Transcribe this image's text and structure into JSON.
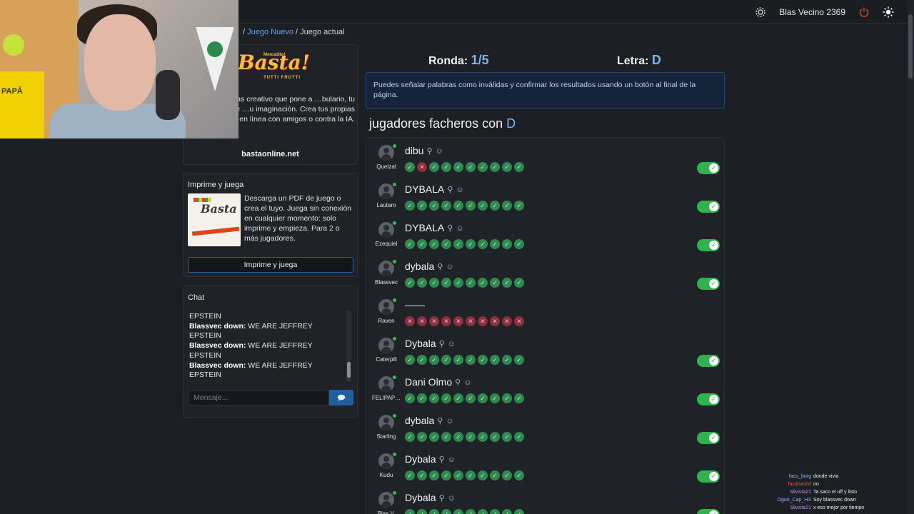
{
  "header": {
    "username": "Blas Vecino 2369",
    "icons": [
      "gear-icon",
      "power-icon",
      "sun-icon"
    ]
  },
  "breadcrumb": {
    "sep1": "/",
    "juego_nuevo": "Juego Nuevo",
    "sep2": "/",
    "current": "Juego actual"
  },
  "promo": {
    "logo_small": "Mercadito!",
    "logo": "Basta!",
    "logo_sub": "TUTTI FRUTTI",
    "description": "…alabras creativo que pone a …bulario, tu capacidad de …u imaginación. Crea tus propias …ega en línea con amigos o contra la IA.",
    "link": "bastaonline.net"
  },
  "print": {
    "title": "Imprime y juega",
    "description": "Descarga un PDF de juego o crea el tuyo. Juega sin conexión en cualquier momento: solo imprime y empieza. Para 2 o más jugadores.",
    "button": "Imprime y juega"
  },
  "chat": {
    "title": "Chat",
    "messages": [
      {
        "user": "",
        "text": "EPSTEIN"
      },
      {
        "user": "Blassvec down:",
        "text": "WE ARE JEFFREY EPSTEIN"
      },
      {
        "user": "Blassvec down:",
        "text": "WE ARE JEFFREY EPSTEIN"
      },
      {
        "user": "Blassvec down:",
        "text": "WE ARE JEFFREY EPSTEIN"
      }
    ],
    "placeholder": "Mensaje..."
  },
  "game": {
    "round_label": "Ronda:",
    "round_value": "1/5",
    "letter_label": "Letra:",
    "letter_value": "D",
    "info": "Puedes señalar palabras como inválidas y confirmar los resultados usando un botón al final de la página.",
    "category": "jugadores facheros con",
    "category_letter": "D"
  },
  "answers": [
    {
      "player": "Quetzal",
      "word": "dibu",
      "votes": [
        "ok",
        "bad",
        "ok",
        "ok",
        "ok",
        "ok",
        "ok",
        "ok",
        "ok",
        "ok"
      ],
      "valid": true
    },
    {
      "player": "Lautaro",
      "word": "DYBALA",
      "votes": [
        "ok",
        "ok",
        "ok",
        "ok",
        "ok",
        "ok",
        "ok",
        "ok",
        "ok",
        "ok"
      ],
      "valid": true
    },
    {
      "player": "Ezequiel",
      "word": "DYBALA",
      "votes": [
        "ok",
        "ok",
        "ok",
        "ok",
        "ok",
        "ok",
        "ok",
        "ok",
        "ok",
        "ok"
      ],
      "valid": true
    },
    {
      "player": "Blassvec",
      "word": "dybala",
      "votes": [
        "ok",
        "ok",
        "ok",
        "ok",
        "ok",
        "ok",
        "ok",
        "ok",
        "ok",
        "ok"
      ],
      "valid": true
    },
    {
      "player": "Raven",
      "word": "——",
      "votes": [
        "bad",
        "bad",
        "bad",
        "bad",
        "bad",
        "bad",
        "bad",
        "bad",
        "bad",
        "bad"
      ],
      "valid": false
    },
    {
      "player": "Caterpill",
      "word": "Dybala",
      "votes": [
        "ok",
        "ok",
        "ok",
        "ok",
        "ok",
        "ok",
        "ok",
        "ok",
        "ok",
        "ok"
      ],
      "valid": true
    },
    {
      "player": "FELIPAP…",
      "word": "Dani Olmo",
      "votes": [
        "ok",
        "ok",
        "ok",
        "ok",
        "ok",
        "ok",
        "ok",
        "ok",
        "ok",
        "ok"
      ],
      "valid": true
    },
    {
      "player": "Starling",
      "word": "dybala",
      "votes": [
        "ok",
        "ok",
        "ok",
        "ok",
        "ok",
        "ok",
        "ok",
        "ok",
        "ok",
        "ok"
      ],
      "valid": true
    },
    {
      "player": "Kudu",
      "word": "Dybala",
      "votes": [
        "ok",
        "ok",
        "ok",
        "ok",
        "ok",
        "ok",
        "ok",
        "ok",
        "ok",
        "ok"
      ],
      "valid": true
    },
    {
      "player": "Blas V.",
      "word": "Dybala",
      "votes": [
        "ok",
        "ok",
        "ok",
        "ok",
        "ok",
        "ok",
        "ok",
        "ok",
        "ok",
        "ok"
      ],
      "valid": true
    }
  ],
  "stream_chat": [
    {
      "user": "facu_burg",
      "text": "donde vivia",
      "color": "#8fb8ff"
    },
    {
      "user": "fucahashd",
      "text": "no",
      "color": "#ff4d4d"
    },
    {
      "user": "Silvista21",
      "text": "Ta saco el uff y listo",
      "color": "#c78cff"
    },
    {
      "user": "Oguri_Cap_HX",
      "text": "Soy blassvec down",
      "color": "#8fb8ff"
    },
    {
      "user": "Silvista21",
      "text": "x eso mejor por tiempo",
      "color": "#c78cff"
    }
  ],
  "webcam_poster": "PAPÁ"
}
